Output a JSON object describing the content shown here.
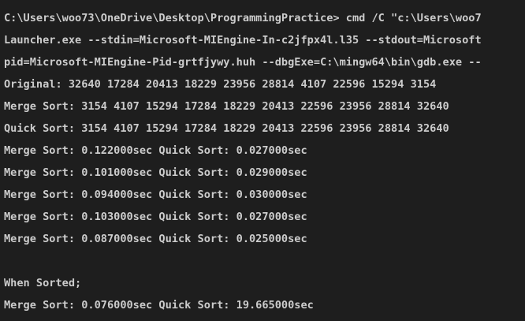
{
  "terminal": {
    "lines": [
      "C:\\Users\\woo73\\OneDrive\\Desktop\\ProgrammingPractice> cmd /C \"c:\\Users\\woo7",
      "Launcher.exe --stdin=Microsoft-MIEngine-In-c2jfpx4l.l35 --stdout=Microsoft",
      "pid=Microsoft-MIEngine-Pid-grtfjywy.huh --dbgExe=C:\\mingw64\\bin\\gdb.exe --",
      "Original: 32640 17284 20413 18229 23956 28814 4107 22596 15294 3154",
      "Merge Sort: 3154 4107 15294 17284 18229 20413 22596 23956 28814 32640",
      "Quick Sort: 3154 4107 15294 17284 18229 20413 22596 23956 28814 32640",
      "Merge Sort: 0.122000sec Quick Sort: 0.027000sec",
      "Merge Sort: 0.101000sec Quick Sort: 0.029000sec",
      "Merge Sort: 0.094000sec Quick Sort: 0.030000sec",
      "Merge Sort: 0.103000sec Quick Sort: 0.027000sec",
      "Merge Sort: 0.087000sec Quick Sort: 0.025000sec",
      "",
      "When Sorted;",
      "Merge Sort: 0.076000sec Quick Sort: 19.665000sec"
    ],
    "colors": {
      "background": "#1e1e1e",
      "text": "#cccccc"
    }
  }
}
